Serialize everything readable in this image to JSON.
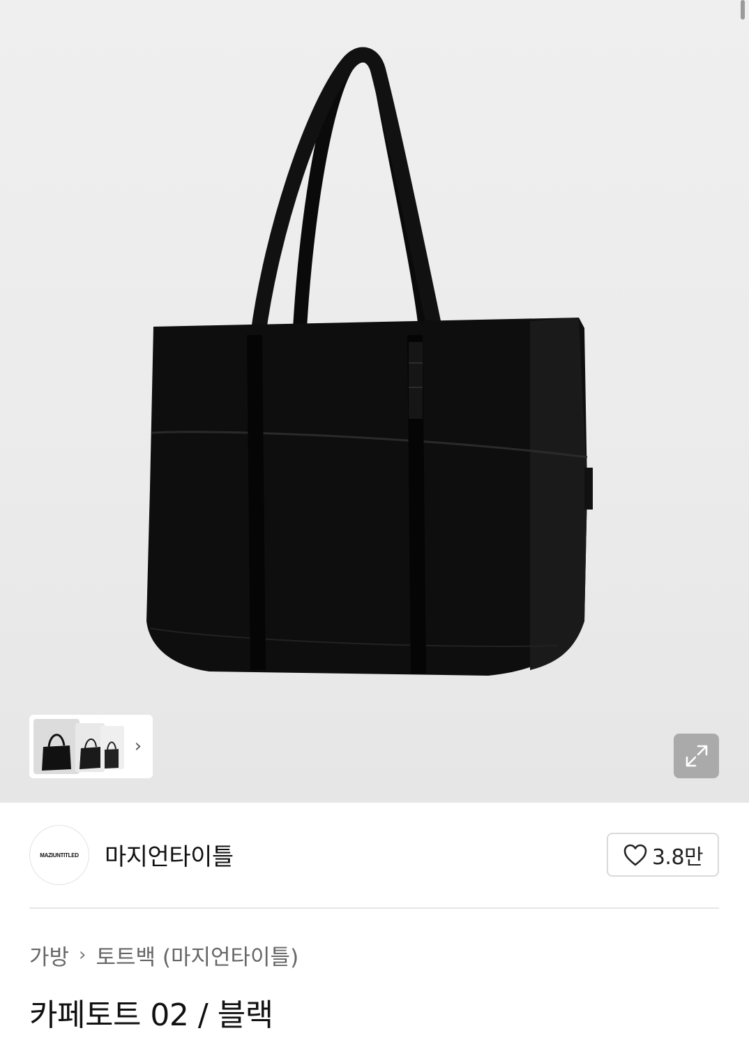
{
  "hero": {
    "image_alt": "black tote bag product photo",
    "thumbnail_count": 3
  },
  "brand": {
    "logo_text": "MAZIUNTITLED",
    "name": "마지언타이틀"
  },
  "like": {
    "count": "3.8만"
  },
  "breadcrumb": {
    "category": "가방",
    "subcategory": "토트백 (마지언타이틀)"
  },
  "product": {
    "title": "카페토트 02 / 블랙"
  },
  "colors": {
    "bag": "#0d0d0d",
    "background": "#ececec"
  }
}
